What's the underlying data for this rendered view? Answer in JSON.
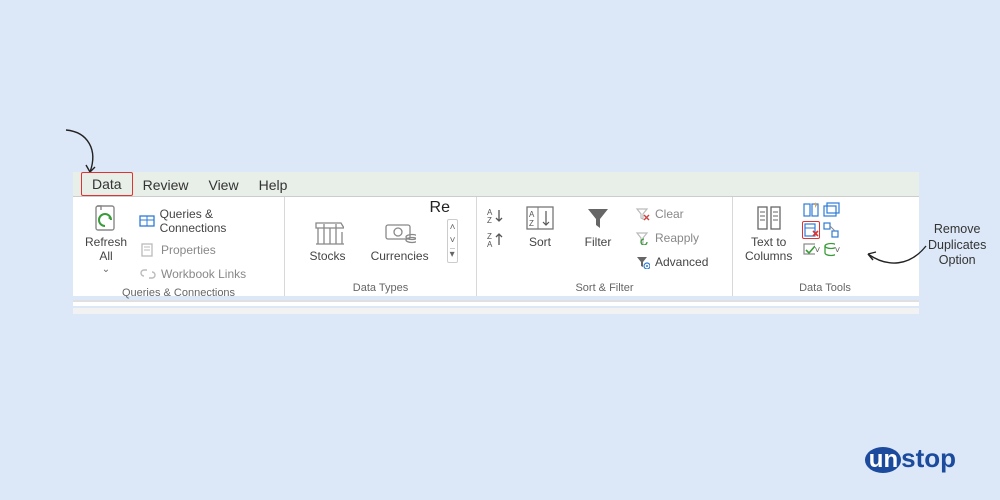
{
  "tabs": {
    "data": "Data",
    "review": "Review",
    "view": "View",
    "help": "Help"
  },
  "queries_group": {
    "refresh": "Refresh\nAll",
    "qc": "Queries & Connections",
    "props": "Properties",
    "wl": "Workbook Links",
    "label": "Queries & Connections"
  },
  "datatypes_group": {
    "stocks": "Stocks",
    "currencies": "Currencies",
    "re": "Re",
    "label": "Data Types"
  },
  "sortfilter_group": {
    "sort": "Sort",
    "filter": "Filter",
    "clear": "Clear",
    "reapply": "Reapply",
    "advanced": "Advanced",
    "label": "Sort & Filter"
  },
  "datatools_group": {
    "ttc": "Text to\nColumns",
    "label": "Data Tools"
  },
  "annotations": {
    "remove_dup": "Remove\nDuplicates\nOption"
  },
  "brand": "unstop"
}
